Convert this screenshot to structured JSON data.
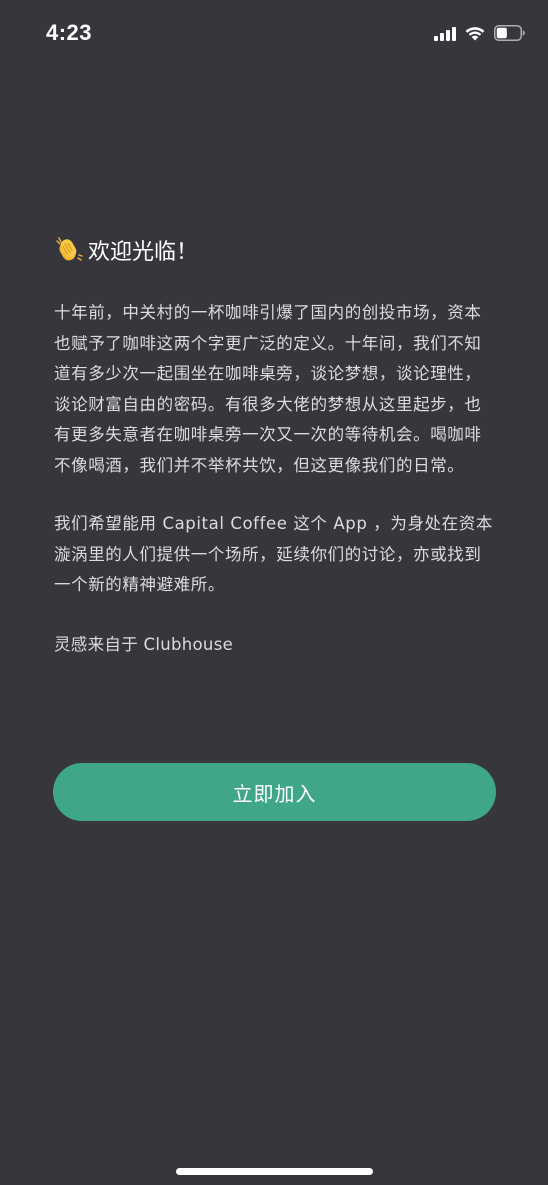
{
  "status_bar": {
    "time": "4:23",
    "icons": [
      "signal-icon",
      "wifi-icon",
      "battery-icon"
    ],
    "battery_level": 0.45
  },
  "welcome": {
    "icon": "clapping-hands-icon",
    "title": "欢迎光临！"
  },
  "paragraphs": [
    "十年前，中关村的一杯咖啡引爆了国内的创投市场，资本也赋予了咖啡这两个字更广泛的定义。十年间，我们不知道有多少次一起围坐在咖啡桌旁，谈论梦想，谈论理性，谈论财富自由的密码。有很多大佬的梦想从这里起步，也有更多失意者在咖啡桌旁一次又一次的等待机会。喝咖啡不像喝酒，我们并不举杯共饮，但这更像我们的日常。",
    "我们希望能用 Capital Coffee 这个 App ，为身处在资本漩涡里的人们提供一个场所，延续你们的讨论，亦或找到一个新的精神避难所。"
  ],
  "inspired_by": "灵感来自于 Clubhouse",
  "join_button": {
    "label": "立即加入"
  },
  "colors": {
    "background": "#37363c",
    "accent": "#3fa68a",
    "text": "#dcdcdc"
  }
}
